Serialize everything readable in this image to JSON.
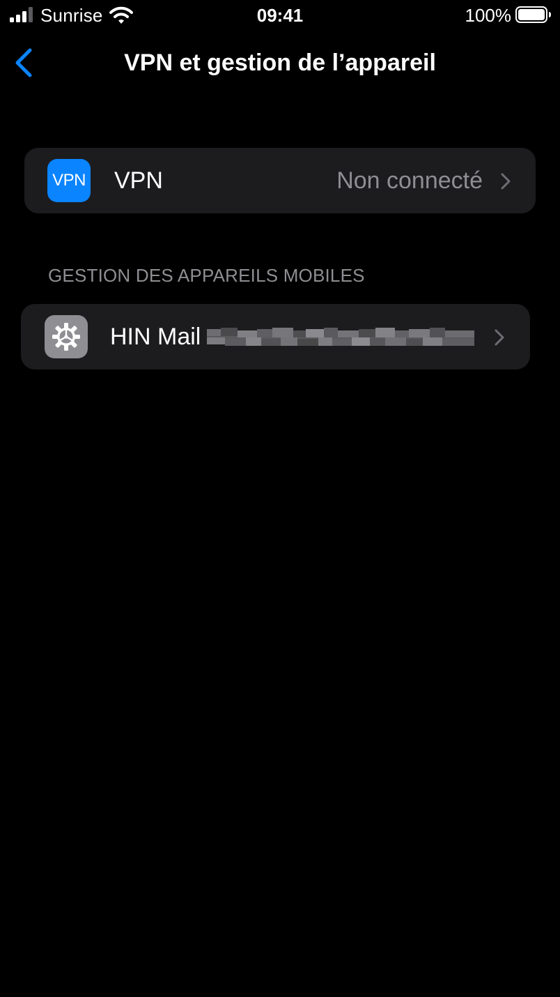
{
  "status_bar": {
    "carrier": "Sunrise",
    "time": "09:41",
    "battery_percent": "100%",
    "signal_bars_active": 3,
    "signal_bars_total": 4
  },
  "nav": {
    "title": "VPN et gestion de l’appareil",
    "back_icon": "chevron-left-icon"
  },
  "vpn_row": {
    "label": "VPN",
    "icon_text": "VPN",
    "value": "Non connecté"
  },
  "mdm_section": {
    "header": "GESTION DES APPAREILS MOBILES",
    "rows": [
      {
        "label": "HIN Mail",
        "icon": "gear-icon"
      }
    ]
  },
  "colors": {
    "background": "#000000",
    "cell_background": "#1c1c1e",
    "accent": "#0a84ff",
    "secondary_text": "#8e8e93",
    "profile_icon_bg": "#8e8e93"
  }
}
